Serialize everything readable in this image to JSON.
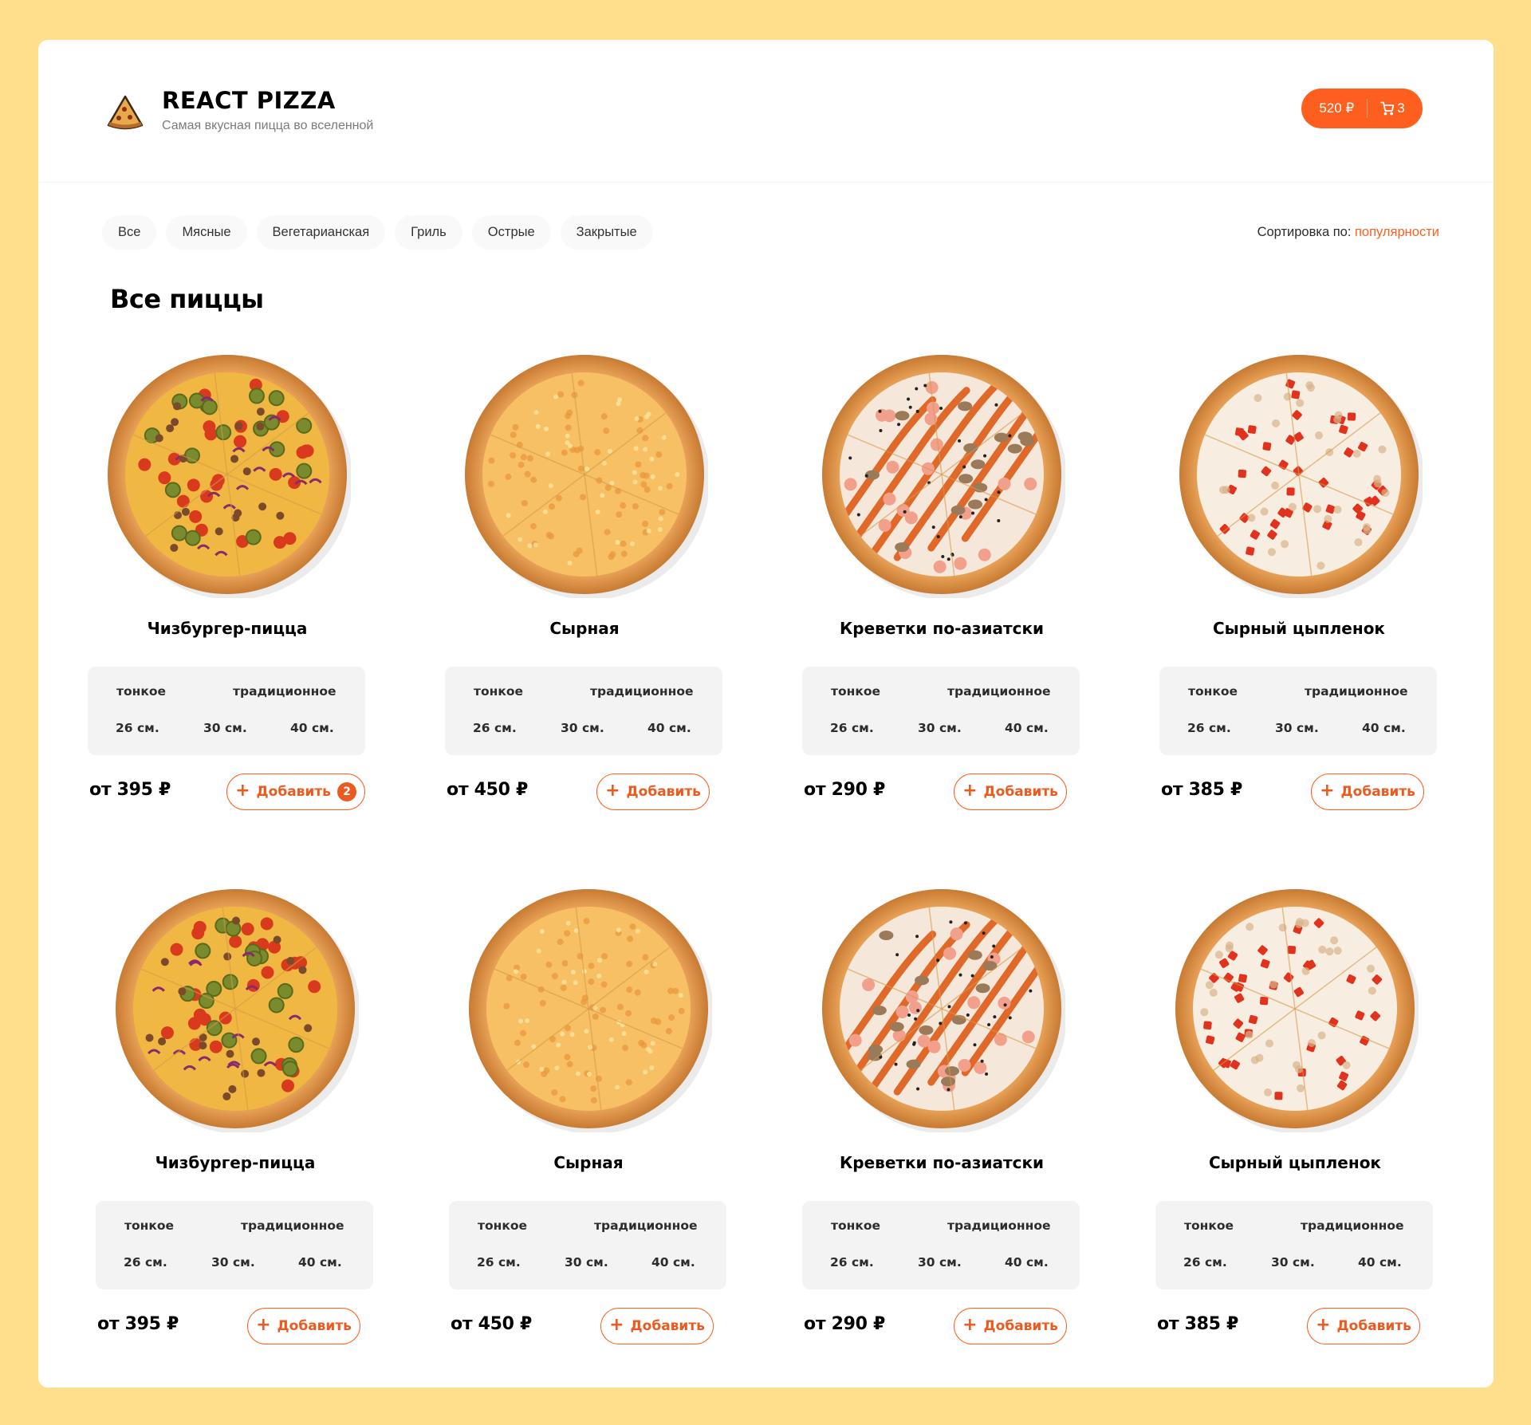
{
  "header": {
    "title": "REACT PIZZA",
    "subtitle": "Самая вкусная пицца во вселенной",
    "cart_total": "520 ₽",
    "cart_count": "3"
  },
  "categories": [
    "Все",
    "Мясные",
    "Вегетарианская",
    "Гриль",
    "Острые",
    "Закрытые"
  ],
  "sort": {
    "label": "Сортировка по:",
    "value": "популярности"
  },
  "page_title": "Все пиццы",
  "dough_types": [
    "тонкое",
    "традиционное"
  ],
  "sizes": [
    "26 см.",
    "30 см.",
    "40 см."
  ],
  "add_label": "Добавить",
  "pizzas": [
    {
      "name": "Чизбургер-пицца",
      "price": "от 395 ₽",
      "count": "2",
      "kind": "cheeseburger"
    },
    {
      "name": "Сырная",
      "price": "от 450 ₽",
      "count": "",
      "kind": "cheese"
    },
    {
      "name": "Креветки по-азиатски",
      "price": "от 290 ₽",
      "count": "",
      "kind": "shrimp"
    },
    {
      "name": "Сырный цыпленок",
      "price": "от 385 ₽",
      "count": "",
      "kind": "chicken"
    },
    {
      "name": "Чизбургер-пицца",
      "price": "от 395 ₽",
      "count": "",
      "kind": "cheeseburger"
    },
    {
      "name": "Сырная",
      "price": "от 450 ₽",
      "count": "",
      "kind": "cheese"
    },
    {
      "name": "Креветки по-азиатски",
      "price": "от 290 ₽",
      "count": "",
      "kind": "shrimp"
    },
    {
      "name": "Сырный цыпленок",
      "price": "от 385 ₽",
      "count": "",
      "kind": "chicken"
    }
  ],
  "colors": {
    "accent": "#FE5F1E",
    "background": "#FFDF8C"
  }
}
